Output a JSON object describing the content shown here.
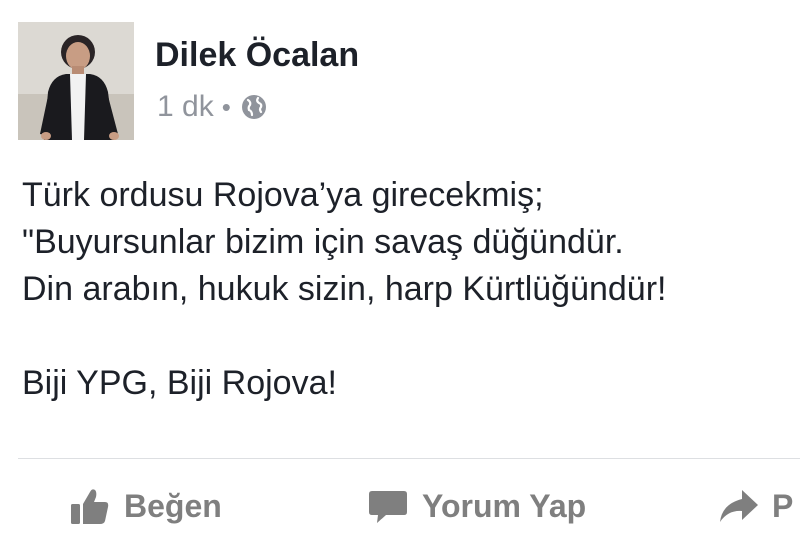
{
  "post": {
    "author": "Dilek Öcalan",
    "timestamp": "1 dk",
    "separator": "•",
    "privacy_icon": "globe-icon",
    "body_lines": [
      "Türk ordusu Rojova’ya girecekmiş;",
      "\"Buyursunlar bizim için savaş düğündür.",
      "Din arabın, hukuk sizin, harp Kürtlüğündür!"
    ],
    "body_closing": "Biji YPG, Biji Rojova!"
  },
  "actions": {
    "like_label": "Beğen",
    "like_icon": "thumbs-up-icon",
    "comment_label": "Yorum Yap",
    "comment_icon": "comment-icon",
    "share_label": "P",
    "share_icon": "share-arrow-icon"
  },
  "colors": {
    "text": "#1d2129",
    "meta": "#90949c",
    "action": "#7f7f7f",
    "divider": "#dddfe2"
  }
}
